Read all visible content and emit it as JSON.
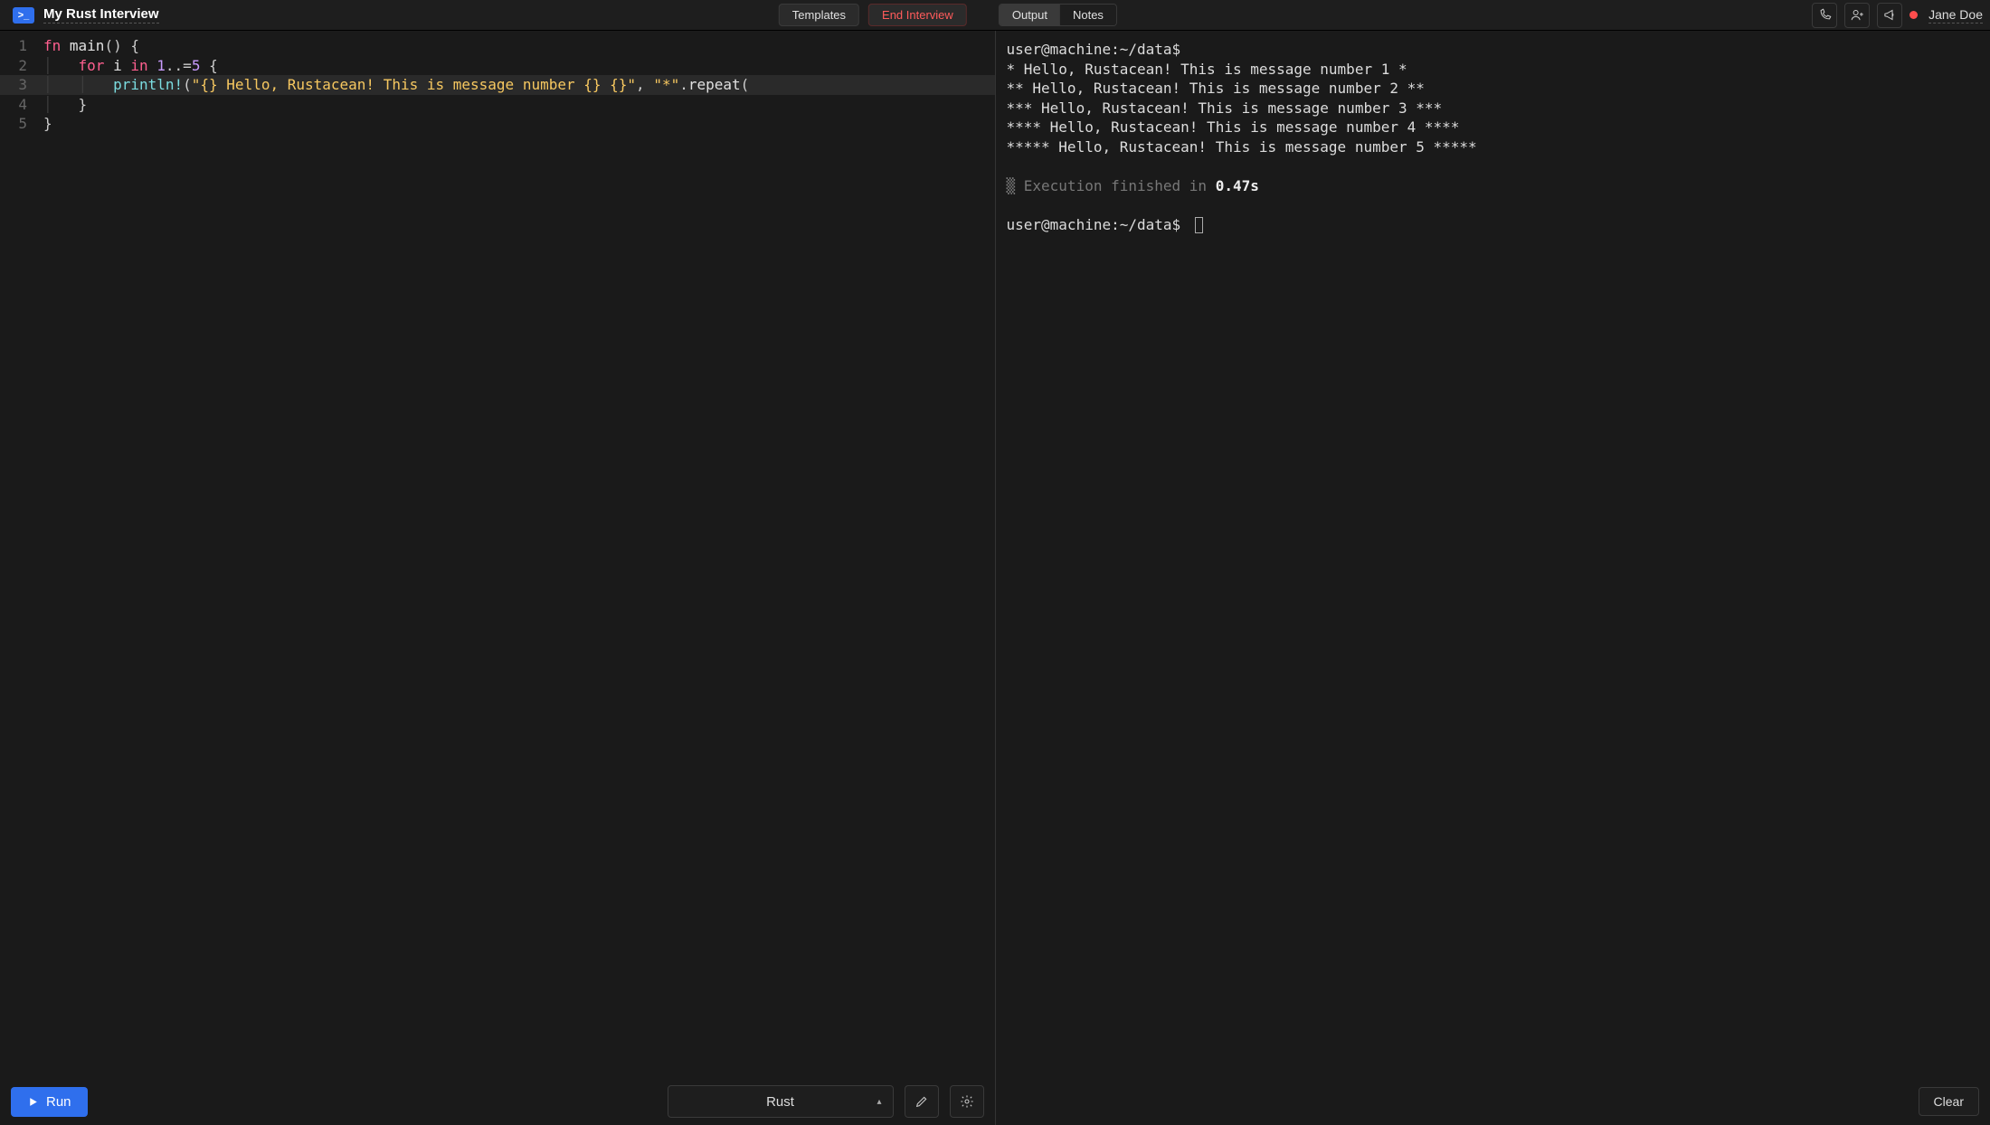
{
  "header": {
    "logo_text": ">_",
    "title": "My Rust Interview",
    "templates_label": "Templates",
    "end_interview_label": "End Interview",
    "tabs": {
      "output": "Output",
      "notes": "Notes",
      "active": "output"
    },
    "recording": true,
    "username": "Jane Doe"
  },
  "editor": {
    "language": "Rust",
    "current_line": 3,
    "lines": [
      {
        "n": 1,
        "indent": 0,
        "raw": "fn main() {",
        "tokens": [
          [
            "kw",
            "fn"
          ],
          [
            "sp",
            " "
          ],
          [
            "fn",
            "main"
          ],
          [
            "punc",
            "()"
          ],
          [
            "sp",
            " "
          ],
          [
            "punc",
            "{"
          ]
        ]
      },
      {
        "n": 2,
        "indent": 1,
        "raw": "for i in 1..=5 {",
        "tokens": [
          [
            "kw",
            "for"
          ],
          [
            "sp",
            " "
          ],
          [
            "fn",
            "i"
          ],
          [
            "sp",
            " "
          ],
          [
            "kw",
            "in"
          ],
          [
            "sp",
            " "
          ],
          [
            "num",
            "1"
          ],
          [
            "punc",
            "..="
          ],
          [
            "num",
            "5"
          ],
          [
            "sp",
            " "
          ],
          [
            "punc",
            "{"
          ]
        ]
      },
      {
        "n": 3,
        "indent": 2,
        "raw": "println!(\"{} Hello, Rustacean! This is message number {} {}\", \"*\".repeat(",
        "tokens": [
          [
            "macro",
            "println!"
          ],
          [
            "punc",
            "("
          ],
          [
            "str",
            "\"{} Hello, Rustacean! This is message number {} {}\""
          ],
          [
            "punc",
            ","
          ],
          [
            "sp",
            " "
          ],
          [
            "str",
            "\"*\""
          ],
          [
            "punc",
            "."
          ],
          [
            "fn",
            "repeat"
          ],
          [
            "punc",
            "("
          ]
        ]
      },
      {
        "n": 4,
        "indent": 1,
        "raw": "}",
        "tokens": [
          [
            "punc",
            "}"
          ]
        ]
      },
      {
        "n": 5,
        "indent": 0,
        "raw": "}",
        "tokens": [
          [
            "punc",
            "}"
          ]
        ]
      }
    ]
  },
  "terminal": {
    "prompt": "user@machine:~/data$",
    "output_lines": [
      "* Hello, Rustacean! This is message number 1 *",
      "** Hello, Rustacean! This is message number 2 **",
      "*** Hello, Rustacean! This is message number 3 ***",
      "**** Hello, Rustacean! This is message number 4 ****",
      "***** Hello, Rustacean! This is message number 5 *****"
    ],
    "exec_marker": "▒",
    "exec_prefix": "Execution finished in ",
    "exec_time": "0.47s"
  },
  "footer": {
    "run_label": "Run",
    "language_label": "Rust",
    "clear_label": "Clear"
  },
  "colors": {
    "accent": "#2f6fed",
    "danger": "#ff5b5b"
  }
}
